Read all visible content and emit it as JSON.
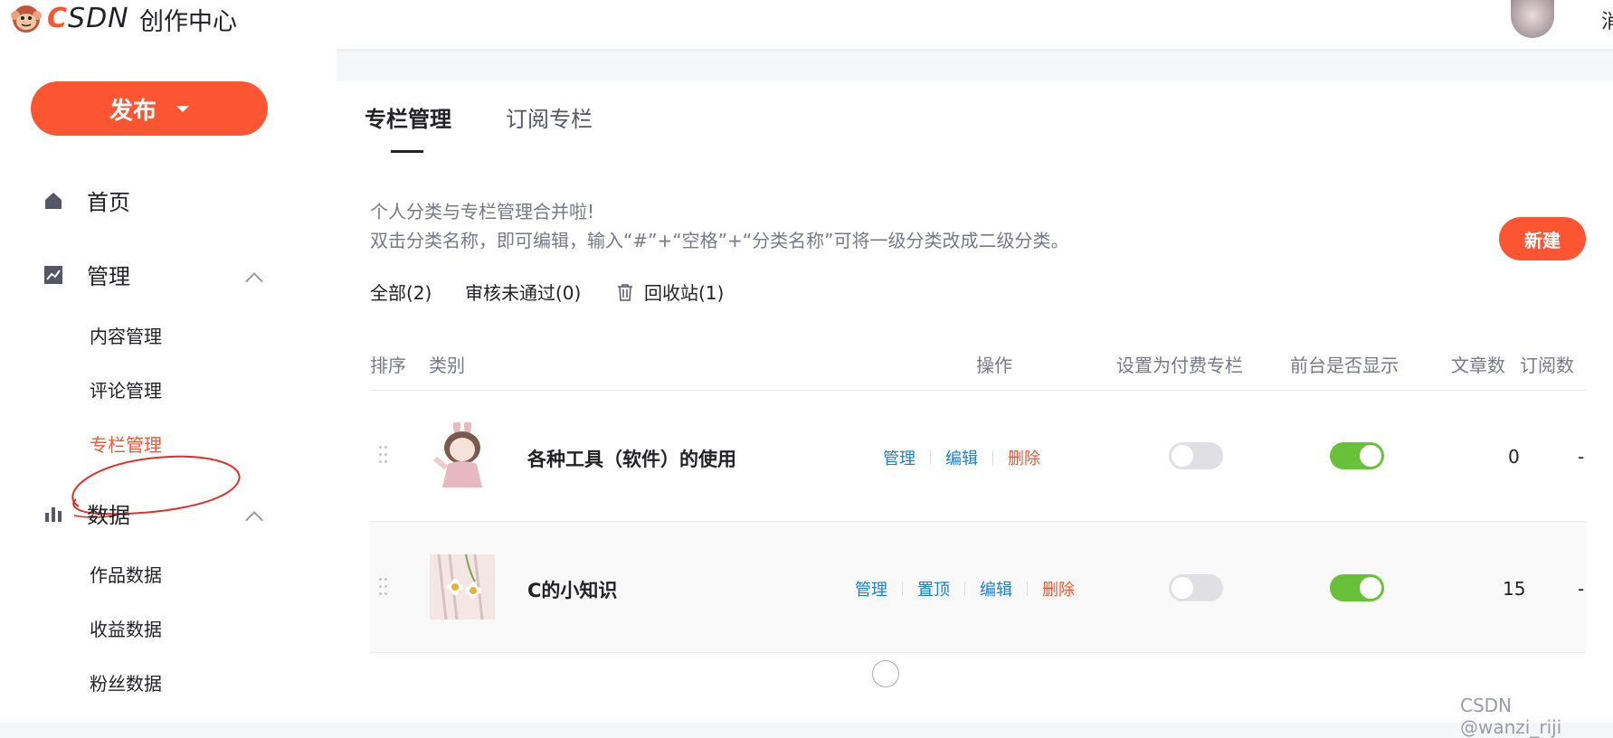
{
  "header": {
    "logo_text_accent": "C",
    "logo_text_rest": "SDN",
    "title": "创作中心",
    "top_right_partial": "消"
  },
  "sidebar": {
    "publish_label": "发布",
    "home_label": "首页",
    "manage_label": "管理",
    "manage_items": [
      "内容管理",
      "评论管理",
      "专栏管理"
    ],
    "data_label": "数据",
    "data_items": [
      "作品数据",
      "收益数据",
      "粉丝数据"
    ]
  },
  "main": {
    "tabs": [
      "专栏管理",
      "订阅专栏"
    ],
    "hint_line1": "个人分类与专栏管理合并啦!",
    "hint_line2": "双击分类名称，即可编辑，输入“#”+“空格”+“分类名称”可将一级分类改成二级分类。",
    "new_button": "新建",
    "filters": [
      "全部(2)",
      "审核未通过(0)",
      "回收站(1)"
    ],
    "table_headers": {
      "sort": "排序",
      "category": "类别",
      "actions": "操作",
      "paid": "设置为付费专栏",
      "visible": "前台是否显示",
      "articles": "文章数",
      "subscribers": "订阅数"
    },
    "rows": [
      {
        "name": "各种工具（软件）的使用",
        "actions": [
          "管理",
          "编辑",
          "删除"
        ],
        "paid_on": false,
        "visible_on": true,
        "articles": "0",
        "subscribers": "-"
      },
      {
        "name": "C的小知识",
        "actions": [
          "管理",
          "置顶",
          "编辑",
          "删除"
        ],
        "paid_on": false,
        "visible_on": true,
        "articles": "15",
        "subscribers": "-"
      }
    ]
  },
  "watermark": "CSDN @wanzi_riji",
  "colors": {
    "brand": "#fc5531",
    "link": "#1d7dd3",
    "toggle_on": "#67c23a",
    "toggle_off": "#e0e0e4"
  }
}
